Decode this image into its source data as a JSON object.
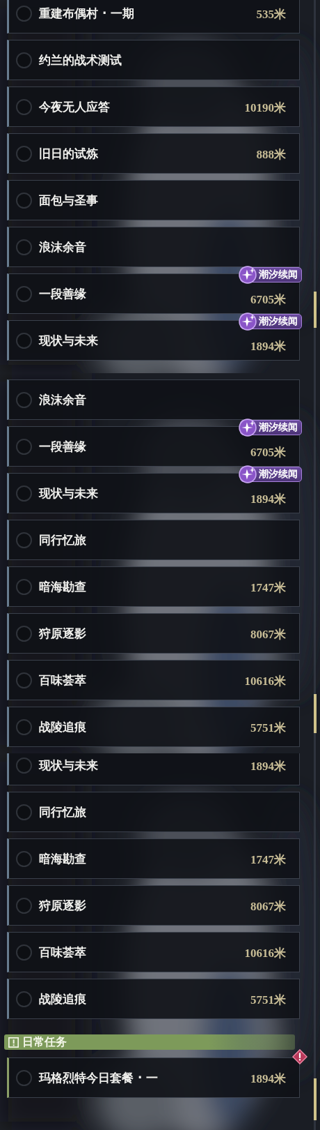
{
  "panels": [
    {
      "items": [
        {
          "kind": "quest",
          "title": "重建布偶村 · 一期",
          "distance": "535米",
          "checked": false,
          "alert": false
        },
        {
          "kind": "quest",
          "title": "约兰的战术测试",
          "checked": false,
          "alert": false
        },
        {
          "kind": "quest",
          "title": "今夜无人应答",
          "distance": "10190米",
          "checked": false,
          "alert": false
        },
        {
          "kind": "quest",
          "title": "旧日的试炼",
          "distance": "888米",
          "checked": false,
          "alert": false
        },
        {
          "kind": "quest",
          "title": "面包与圣事",
          "checked": false,
          "alert": false
        },
        {
          "kind": "quest",
          "title": "浪沫余音",
          "checked": false,
          "alert": false
        },
        {
          "kind": "quest",
          "title": "一段善缘",
          "distance": "6705米",
          "badge": "潮汐续闻",
          "checked": false,
          "alert": false
        },
        {
          "kind": "quest",
          "title": "现状与未来",
          "distance": "1894米",
          "badge": "潮汐续闻",
          "checked": false,
          "alert": false
        }
      ]
    },
    {
      "items": [
        {
          "kind": "quest",
          "title": "浪沫余音",
          "checked": false,
          "alert": false
        },
        {
          "kind": "quest",
          "title": "一段善缘",
          "distance": "6705米",
          "badge": "潮汐续闻",
          "checked": false,
          "alert": false
        },
        {
          "kind": "quest",
          "title": "现状与未来",
          "distance": "1894米",
          "badge": "潮汐续闻",
          "checked": false,
          "alert": false
        },
        {
          "kind": "quest",
          "title": "同行忆旅",
          "checked": false,
          "alert": false
        },
        {
          "kind": "quest",
          "title": "暗海勘查",
          "distance": "1747米",
          "checked": false,
          "alert": false
        },
        {
          "kind": "quest",
          "title": "狩原逐影",
          "distance": "8067米",
          "checked": false,
          "alert": false
        },
        {
          "kind": "quest",
          "title": "百味荟萃",
          "distance": "10616米",
          "checked": false,
          "alert": false
        },
        {
          "kind": "quest",
          "title": "战陵追痕",
          "distance": "5751米",
          "checked": false,
          "alert": false
        }
      ]
    },
    {
      "items": [
        {
          "kind": "quest",
          "title": "现状与未来",
          "distance": "1894米",
          "checked": false,
          "alert": false
        },
        {
          "kind": "quest",
          "title": "同行忆旅",
          "checked": false,
          "alert": false
        },
        {
          "kind": "quest",
          "title": "暗海勘查",
          "distance": "1747米",
          "checked": false,
          "alert": false
        },
        {
          "kind": "quest",
          "title": "狩原逐影",
          "distance": "8067米",
          "checked": false,
          "alert": false
        },
        {
          "kind": "quest",
          "title": "百味荟萃",
          "distance": "10616米",
          "checked": false,
          "alert": false
        },
        {
          "kind": "quest",
          "title": "战陵追痕",
          "distance": "5751米",
          "checked": false,
          "alert": false
        },
        {
          "kind": "section_header",
          "label": "日常任务"
        },
        {
          "kind": "daily_quest",
          "title": "玛格烈特今日套餐 · 一",
          "distance": "1894米",
          "checked": false,
          "alert": true
        }
      ]
    }
  ]
}
